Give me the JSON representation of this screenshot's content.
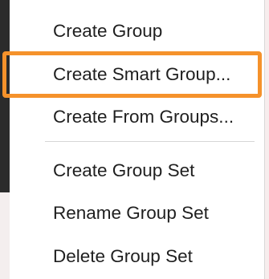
{
  "context_menu": {
    "items": [
      {
        "label": "Create Group"
      },
      {
        "label": "Create Smart Group..."
      },
      {
        "label": "Create From Groups..."
      },
      {
        "label": "Create Group Set"
      },
      {
        "label": "Rename Group Set"
      },
      {
        "label": "Delete Group Set"
      }
    ],
    "highlighted_item": "Create Smart Group...",
    "highlight_color": "#f5922b"
  }
}
